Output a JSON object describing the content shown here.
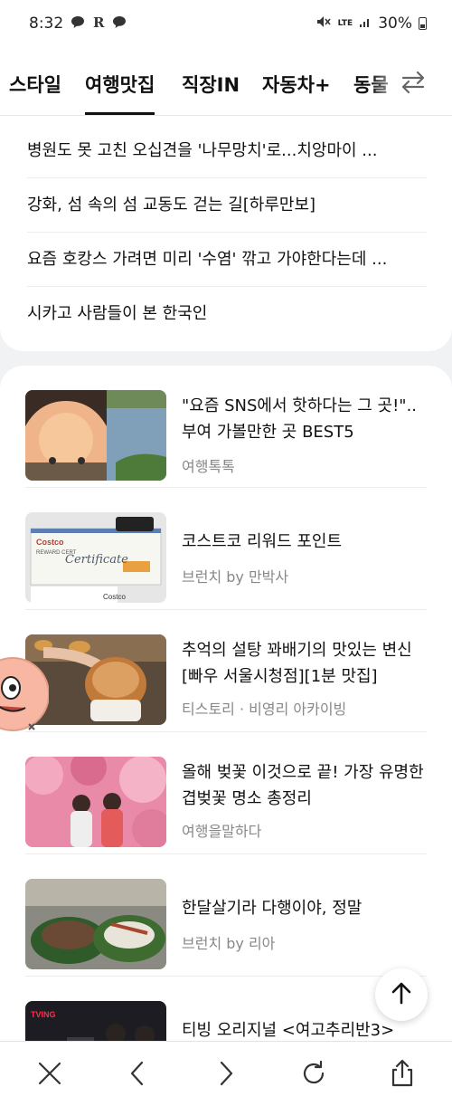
{
  "status_bar": {
    "time": "8:32",
    "app_icons": [
      "chat-icon",
      "r-icon",
      "chat-icon"
    ],
    "network": "LTE",
    "battery": "30%"
  },
  "tabs": [
    {
      "label": "스타일",
      "active": false
    },
    {
      "label": "여행맛집",
      "active": true
    },
    {
      "label": "직장IN",
      "active": false
    },
    {
      "label": "자동차+",
      "active": false
    },
    {
      "label": "동물",
      "active": false
    }
  ],
  "top_headlines": [
    "병원도 못 고친 오십견을 '나무망치'로...치앙마이 ...",
    "강화, 섬 속의 섬 교동도 걷는 길[하루만보]",
    "요즘 호캉스 가려면 미리 '수염' 깎고 가야한다는데 ...",
    "시카고 사람들이 본 한국인"
  ],
  "feed": [
    {
      "title": "\"요즘 SNS에서 핫하다는 그 곳!\".. 부여 가볼만한 곳 BEST5",
      "source": "여행톡톡"
    },
    {
      "title": "코스트코 리워드 포인트",
      "source": "브런치 by 만박사"
    },
    {
      "title": "추억의 설탕 꽈배기의 맛있는 변신 [빠우 서울시청점][1분 맛집]",
      "source": "티스토리 · 비영리 아카이빙"
    },
    {
      "title": "올해 벚꽃 이것으로 끝! 가장 유명한 겹벚꽃 명소 총정리",
      "source": "여행을말하다"
    },
    {
      "title": "한달살기라 다행이야, 정말",
      "source": "브런치 by 리아"
    },
    {
      "title": "티빙 오리지널 <여고추리반3>",
      "source": ""
    }
  ],
  "thumb_text": {
    "costco": "Costco",
    "certificate": "Certificate",
    "reward": "REWARD CERT",
    "tving": "TVING"
  },
  "colors": {
    "background": "#f1f2f4",
    "card": "#ffffff",
    "text": "#111111",
    "muted": "#888888"
  }
}
